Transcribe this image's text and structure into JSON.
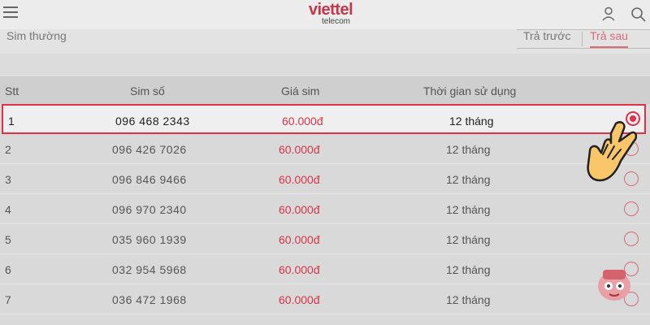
{
  "header": {
    "logo_main": "viettel",
    "logo_sub": "telecom"
  },
  "filter": {
    "category": "Sim thường",
    "tab_prepaid": "Trả trước",
    "tab_postpaid": "Trả sau"
  },
  "table": {
    "headers": {
      "stt": "Stt",
      "number": "Sim số",
      "price": "Giá sim",
      "duration": "Thời gian sử dụng"
    },
    "rows": [
      {
        "stt": "1",
        "number": "096 468 2343",
        "price": "60.000đ",
        "duration": "12 tháng",
        "selected": true
      },
      {
        "stt": "2",
        "number": "096 426 7026",
        "price": "60.000đ",
        "duration": "12 tháng",
        "selected": false
      },
      {
        "stt": "3",
        "number": "096 846 9466",
        "price": "60.000đ",
        "duration": "12 tháng",
        "selected": false
      },
      {
        "stt": "4",
        "number": "096 970 2340",
        "price": "60.000đ",
        "duration": "12 tháng",
        "selected": false
      },
      {
        "stt": "5",
        "number": "035 960 1939",
        "price": "60.000đ",
        "duration": "12 tháng",
        "selected": false
      },
      {
        "stt": "6",
        "number": "032 954 5968",
        "price": "60.000đ",
        "duration": "12 tháng",
        "selected": false
      },
      {
        "stt": "7",
        "number": "036 472 1968",
        "price": "60.000đ",
        "duration": "12 tháng",
        "selected": false
      }
    ]
  },
  "colors": {
    "accent": "#e0314b",
    "brand": "#c2374b"
  },
  "icons": {
    "menu": "menu-icon",
    "user": "user-icon",
    "search": "search-icon",
    "pointer": "hand-pointer-icon",
    "mascot": "chat-mascot-icon"
  }
}
